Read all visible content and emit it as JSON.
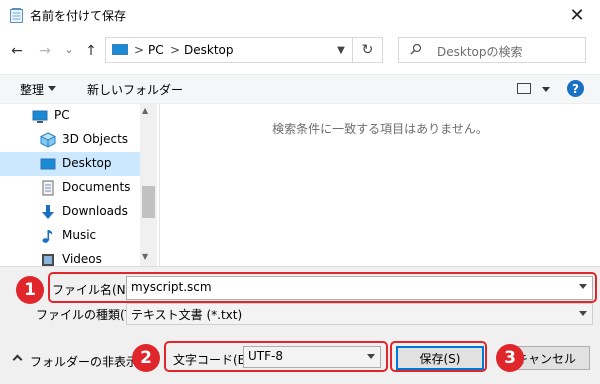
{
  "window": {
    "title": "名前を付けて保存",
    "close_glyph": "✕"
  },
  "nav": {
    "back_glyph": "←",
    "forward_glyph": "→",
    "recent_glyph": "⌄",
    "up_glyph": "↑",
    "breadcrumb": [
      "PC",
      "Desktop"
    ],
    "breadcrumb_sep": ">",
    "refresh_glyph": "↻",
    "search_placeholder": "Desktopの検索"
  },
  "toolbar": {
    "organize_label": "整理",
    "new_folder_label": "新しいフォルダー",
    "help_label": "?"
  },
  "tree": {
    "items": [
      {
        "label": "PC",
        "icon": "pc-icon",
        "selected": false
      },
      {
        "label": "3D Objects",
        "icon": "cube-icon",
        "selected": false
      },
      {
        "label": "Desktop",
        "icon": "desktop-icon",
        "selected": true
      },
      {
        "label": "Documents",
        "icon": "document-icon",
        "selected": false
      },
      {
        "label": "Downloads",
        "icon": "download-icon",
        "selected": false
      },
      {
        "label": "Music",
        "icon": "music-icon",
        "selected": false
      },
      {
        "label": "Videos",
        "icon": "video-icon",
        "selected": false
      }
    ]
  },
  "content": {
    "empty_message": "検索条件に一致する項目はありません。"
  },
  "form": {
    "filename_label": "ファイル名(N):",
    "filename_value": "myscript.scm",
    "filetype_label": "ファイルの種類(T):",
    "filetype_value": "テキスト文書 (*.txt)",
    "encoding_label": "文字コード(E):",
    "encoding_value": "UTF-8"
  },
  "footer": {
    "hide_folders_label": "フォルダーの非表示",
    "save_label": "保存(S)",
    "cancel_label": "キャンセル"
  },
  "annotations": {
    "badge_1": "1",
    "badge_2": "2",
    "badge_3": "3",
    "color": "#e0262a"
  },
  "colors": {
    "accent": "#0078d7",
    "selected_bg": "#cce8ff",
    "help_bg": "#1a70c2"
  }
}
